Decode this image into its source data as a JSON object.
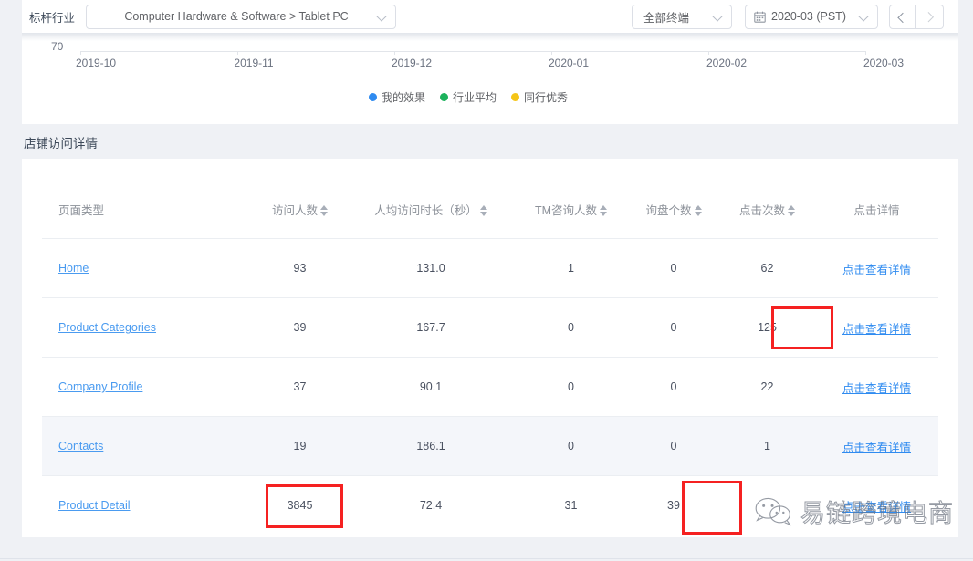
{
  "topbar": {
    "label": "标杆行业",
    "industry_value": "Computer Hardware & Software > Tablet PC",
    "device_value": "全部终端",
    "date_value": "2020-03 (PST)",
    "prev_label": "<",
    "next_label": ">"
  },
  "chart_data": {
    "type": "line",
    "title": "",
    "xlabel": "",
    "ylabel": "",
    "y_axis_label": "70",
    "categories": [
      "2019-10",
      "2019-11",
      "2019-12",
      "2020-01",
      "2020-02",
      "2020-03"
    ],
    "series": [
      {
        "name": "我的效果",
        "color": "#2f8bf0",
        "values": []
      },
      {
        "name": "行业平均",
        "color": "#1cb25c",
        "values": []
      },
      {
        "name": "同行优秀",
        "color": "#f5c518",
        "values": []
      }
    ],
    "legend_position": "bottom",
    "grid": false,
    "note": "Only the bottom axis of the chart is visible in this cropped screenshot"
  },
  "section": {
    "title": "店铺访问详情"
  },
  "table": {
    "columns": [
      {
        "label": "页面类型",
        "sortable": false
      },
      {
        "label": "访问人数",
        "sortable": true
      },
      {
        "label": "人均访问时长（秒）",
        "sortable": true
      },
      {
        "label": "TM咨询人数",
        "sortable": true
      },
      {
        "label": "询盘个数",
        "sortable": true
      },
      {
        "label": "点击次数",
        "sortable": true
      },
      {
        "label": "点击详情",
        "sortable": false
      }
    ],
    "rows": [
      {
        "page": "Home",
        "visitors": "93",
        "avg_duration": "131.0",
        "tm": "1",
        "inquiries": "0",
        "clicks": "62",
        "detail": "点击查看详情"
      },
      {
        "page": "Product Categories",
        "visitors": "39",
        "avg_duration": "167.7",
        "tm": "0",
        "inquiries": "0",
        "clicks": "125",
        "detail": "点击查看详情"
      },
      {
        "page": "Company Profile",
        "visitors": "37",
        "avg_duration": "90.1",
        "tm": "0",
        "inquiries": "0",
        "clicks": "22",
        "detail": "点击查看详情"
      },
      {
        "page": "Contacts",
        "visitors": "19",
        "avg_duration": "186.1",
        "tm": "0",
        "inquiries": "0",
        "clicks": "1",
        "detail": "点击查看详情"
      },
      {
        "page": "Product Detail",
        "visitors": "3845",
        "avg_duration": "72.4",
        "tm": "31",
        "inquiries": "39",
        "clicks": "",
        "detail": "点击查看详情"
      }
    ]
  },
  "annotations": {
    "highlight_color": "#f52121",
    "boxes": [
      {
        "target": "clicks of Product Categories",
        "value": "125"
      },
      {
        "target": "visitors of Product Detail",
        "value": "3845"
      },
      {
        "target": "inquiries of Product Detail",
        "value": "39"
      }
    ]
  },
  "watermark": {
    "text": "易链跨境电商",
    "icon": "wechat-icon"
  }
}
